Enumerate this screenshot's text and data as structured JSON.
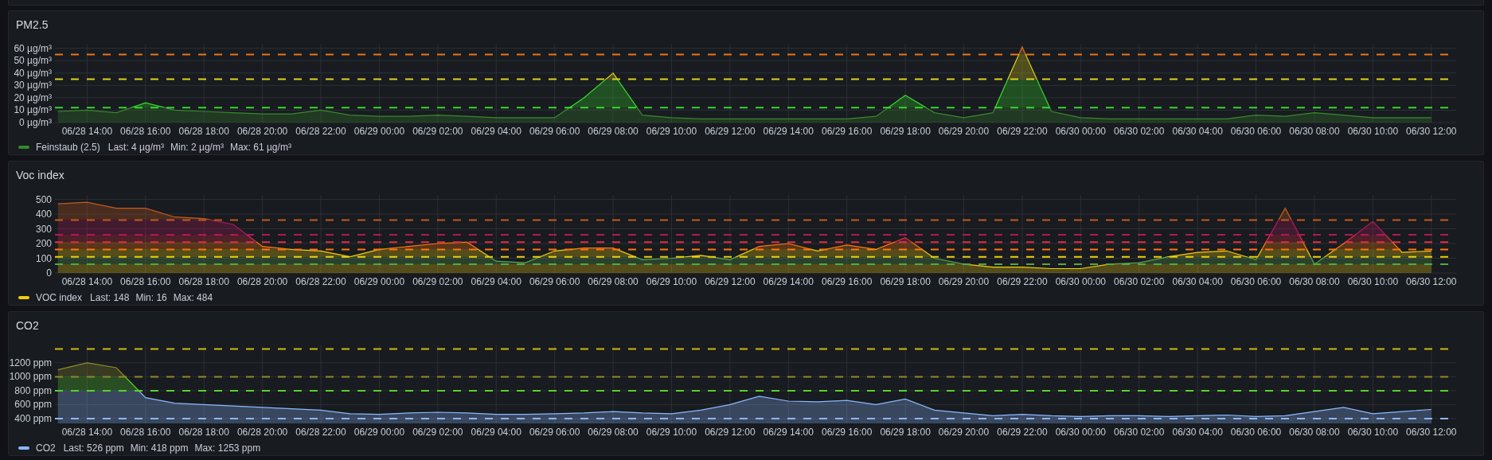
{
  "panels": [
    {
      "title": "PM2.5",
      "chart_data": {
        "type": "area",
        "categories": [
          null,
          "06/28 14:00",
          null,
          "06/28 16:00",
          null,
          "06/28 18:00",
          null,
          "06/28 20:00",
          null,
          "06/28 22:00",
          null,
          "06/29 00:00",
          null,
          "06/29 02:00",
          null,
          "06/29 04:00",
          null,
          "06/29 06:00",
          null,
          "06/29 08:00",
          null,
          "06/29 10:00",
          null,
          "06/29 12:00",
          null,
          "06/29 14:00",
          null,
          "06/29 16:00",
          null,
          "06/29 18:00",
          null,
          "06/29 20:00",
          null,
          "06/29 22:00",
          null,
          "06/30 00:00",
          null,
          "06/30 02:00",
          null,
          "06/30 04:00",
          null,
          "06/30 06:00",
          null,
          "06/30 08:00",
          null,
          "06/30 10:00",
          null,
          "06/30 12:00"
        ],
        "series": [
          {
            "name": "Feinstaub (2.5)",
            "color": "#37872d",
            "values": [
              9,
              10,
              8,
              16,
              10,
              9,
              8,
              7,
              7,
              10,
              6,
              5,
              5,
              6,
              5,
              4,
              4,
              4,
              20,
              40,
              6,
              4,
              3,
              3,
              3,
              3,
              3,
              3,
              5,
              22,
              8,
              4,
              8,
              61,
              9,
              4,
              3,
              3,
              3,
              3,
              3,
              6,
              5,
              8,
              6,
              4,
              4,
              4
            ]
          }
        ],
        "ylim": [
          0,
          63
        ],
        "grid": true,
        "yticks": [
          {
            "value": 0,
            "label": "0 µg/m³"
          },
          {
            "value": 10,
            "label": "10 µg/m³"
          },
          {
            "value": 20,
            "label": "20 µg/m³"
          },
          {
            "value": 30,
            "label": "30 µg/m³"
          },
          {
            "value": 40,
            "label": "40 µg/m³"
          },
          {
            "value": 50,
            "label": "50 µg/m³"
          },
          {
            "value": 60,
            "label": "60 µg/m³"
          }
        ],
        "ref_lines": [
          {
            "axis": "y",
            "value": 12,
            "color": "#37d72d"
          },
          {
            "axis": "y",
            "value": 35,
            "color": "#e0d21a"
          },
          {
            "axis": "y",
            "value": 55,
            "color": "#e8741c"
          }
        ]
      },
      "legend": {
        "stats": [
          "Last: 4 µg/m³",
          "Min: 2 µg/m³",
          "Max: 61 µg/m³"
        ]
      }
    },
    {
      "title": "Voc index",
      "chart_data": {
        "type": "area",
        "categories": [
          null,
          "06/28 14:00",
          null,
          "06/28 16:00",
          null,
          "06/28 18:00",
          null,
          "06/28 20:00",
          null,
          "06/28 22:00",
          null,
          "06/29 00:00",
          null,
          "06/29 02:00",
          null,
          "06/29 04:00",
          null,
          "06/29 06:00",
          null,
          "06/29 08:00",
          null,
          "06/29 10:00",
          null,
          "06/29 12:00",
          null,
          "06/29 14:00",
          null,
          "06/29 16:00",
          null,
          "06/29 18:00",
          null,
          "06/29 20:00",
          null,
          "06/29 22:00",
          null,
          "06/30 00:00",
          null,
          "06/30 02:00",
          null,
          "06/30 04:00",
          null,
          "06/30 06:00",
          null,
          "06/30 08:00",
          null,
          "06/30 10:00",
          null,
          "06/30 12:00"
        ],
        "series": [
          {
            "name": "VOC index",
            "color": "#f2cc0c",
            "values": [
              470,
              480,
              440,
              440,
              380,
              370,
              330,
              180,
              160,
              150,
              110,
              160,
              180,
              200,
              210,
              80,
              70,
              150,
              170,
              170,
              90,
              100,
              120,
              90,
              180,
              200,
              150,
              190,
              160,
              240,
              100,
              60,
              40,
              40,
              30,
              30,
              60,
              70,
              110,
              140,
              150,
              90,
              440,
              60,
              200,
              350,
              140,
              150
            ]
          }
        ],
        "ylim": [
          0,
          530
        ],
        "grid": true,
        "yticks": [
          0,
          100,
          200,
          300,
          400,
          500
        ],
        "ref_lines": [
          {
            "axis": "y",
            "value": 60,
            "color": "#56a64b"
          },
          {
            "axis": "y",
            "value": 110,
            "color": "#f2cc0c"
          },
          {
            "axis": "y",
            "value": 160,
            "color": "#ff780a"
          },
          {
            "axis": "y",
            "value": 210,
            "color": "#e02f44"
          },
          {
            "axis": "y",
            "value": 260,
            "color": "#b0185c"
          },
          {
            "axis": "y",
            "value": 360,
            "color": "#c4591f"
          }
        ]
      },
      "legend": {
        "stats": [
          "Last: 148",
          "Min: 16",
          "Max: 484"
        ]
      }
    },
    {
      "title": "CO2",
      "chart_data": {
        "type": "area",
        "categories": [
          null,
          "06/28 14:00",
          null,
          "06/28 16:00",
          null,
          "06/28 18:00",
          null,
          "06/28 20:00",
          null,
          "06/28 22:00",
          null,
          "06/29 00:00",
          null,
          "06/29 02:00",
          null,
          "06/29 04:00",
          null,
          "06/29 06:00",
          null,
          "06/29 08:00",
          null,
          "06/29 10:00",
          null,
          "06/29 12:00",
          null,
          "06/29 14:00",
          null,
          "06/29 16:00",
          null,
          "06/29 18:00",
          null,
          "06/29 20:00",
          null,
          "06/29 22:00",
          null,
          "06/30 00:00",
          null,
          "06/30 02:00",
          null,
          "06/30 04:00",
          null,
          "06/30 06:00",
          null,
          "06/30 08:00",
          null,
          "06/30 10:00",
          null,
          "06/30 12:00"
        ],
        "series": [
          {
            "name": "CO2",
            "color": "#8ab8ff",
            "values": [
              1100,
              1200,
              1130,
              700,
              620,
              600,
              580,
              560,
              540,
              520,
              470,
              460,
              480,
              490,
              480,
              460,
              460,
              470,
              480,
              500,
              480,
              470,
              520,
              600,
              720,
              650,
              640,
              660,
              600,
              680,
              520,
              480,
              440,
              460,
              440,
              430,
              440,
              440,
              430,
              440,
              450,
              430,
              440,
              500,
              560,
              470,
              500,
              530
            ]
          }
        ],
        "ylim": [
          330,
          1450
        ],
        "grid": true,
        "yticks": [
          {
            "value": 400,
            "label": "400 ppm"
          },
          {
            "value": 600,
            "label": "600 ppm"
          },
          {
            "value": 800,
            "label": "800 ppm"
          },
          {
            "value": 1000,
            "label": "1000 ppm"
          },
          {
            "value": 1200,
            "label": "1200 ppm"
          }
        ],
        "ref_lines": [
          {
            "axis": "y",
            "value": 400,
            "color": "#8ab8ff"
          },
          {
            "axis": "y",
            "value": 800,
            "color": "#56d22f"
          },
          {
            "axis": "y",
            "value": 1000,
            "color": "#8f8a2a"
          },
          {
            "axis": "y",
            "value": 1400,
            "color": "#d4b80c"
          }
        ]
      },
      "legend": {
        "stats": [
          "Last: 526 ppm",
          "Min: 418 ppm",
          "Max: 1253 ppm"
        ]
      }
    }
  ]
}
